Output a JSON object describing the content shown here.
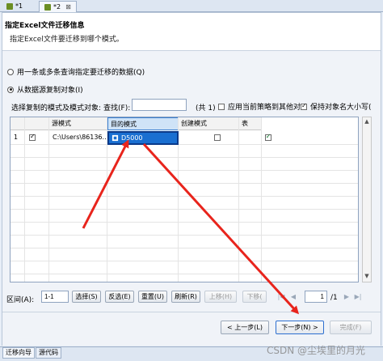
{
  "tabs": [
    {
      "label": "*1",
      "active": false
    },
    {
      "label": "*2",
      "active": true,
      "close": "⊠"
    }
  ],
  "header": {
    "title": "指定Excel文件迁移信息",
    "description": "指定Excel文件要迁移到哪个模式。"
  },
  "options": {
    "query_label": "用一条或多条查询指定要迁移的数据(Q)",
    "copy_label": "从数据源复制对象(I)"
  },
  "filter_bar": {
    "instruction": "选择复制的模式及模式对象:",
    "search_label": "查找(F):",
    "search_value": "",
    "count": "(共 1)",
    "apply_strategy_label": "应用当前策略到其他对",
    "keep_case_label": "保持对象名大小写(",
    "apply_strategy_checked": false,
    "keep_case_checked": true
  },
  "table": {
    "columns": [
      "源模式",
      "目的模式",
      "创建模式",
      "表"
    ],
    "rows": [
      {
        "index": "1",
        "checked": true,
        "source": "C:\\Users\\86136...",
        "target": "D5000",
        "create_schema": false,
        "table": true
      }
    ]
  },
  "bottom": {
    "range_label": "区间(A):",
    "range_value": "1-1",
    "select_button": "选择(S)",
    "invert_button": "反选(E)",
    "reset_button": "重置(U)",
    "refresh_button": "刷新(R)",
    "move_up_button": "上移(H)",
    "move_down_button": "下移(",
    "page_value": "1",
    "page_total": "/1"
  },
  "wizard": {
    "prev_button": "< 上一步(L)",
    "next_button": "下一步(N) >",
    "finish_button": "完成(F)"
  },
  "bottom_tabs": [
    "迁移向导",
    "源代码"
  ],
  "watermark": "CSDN @尘埃里的月光",
  "colors": {
    "selection": "#1a6fd1",
    "annotation_arrow": "#e8241c"
  }
}
